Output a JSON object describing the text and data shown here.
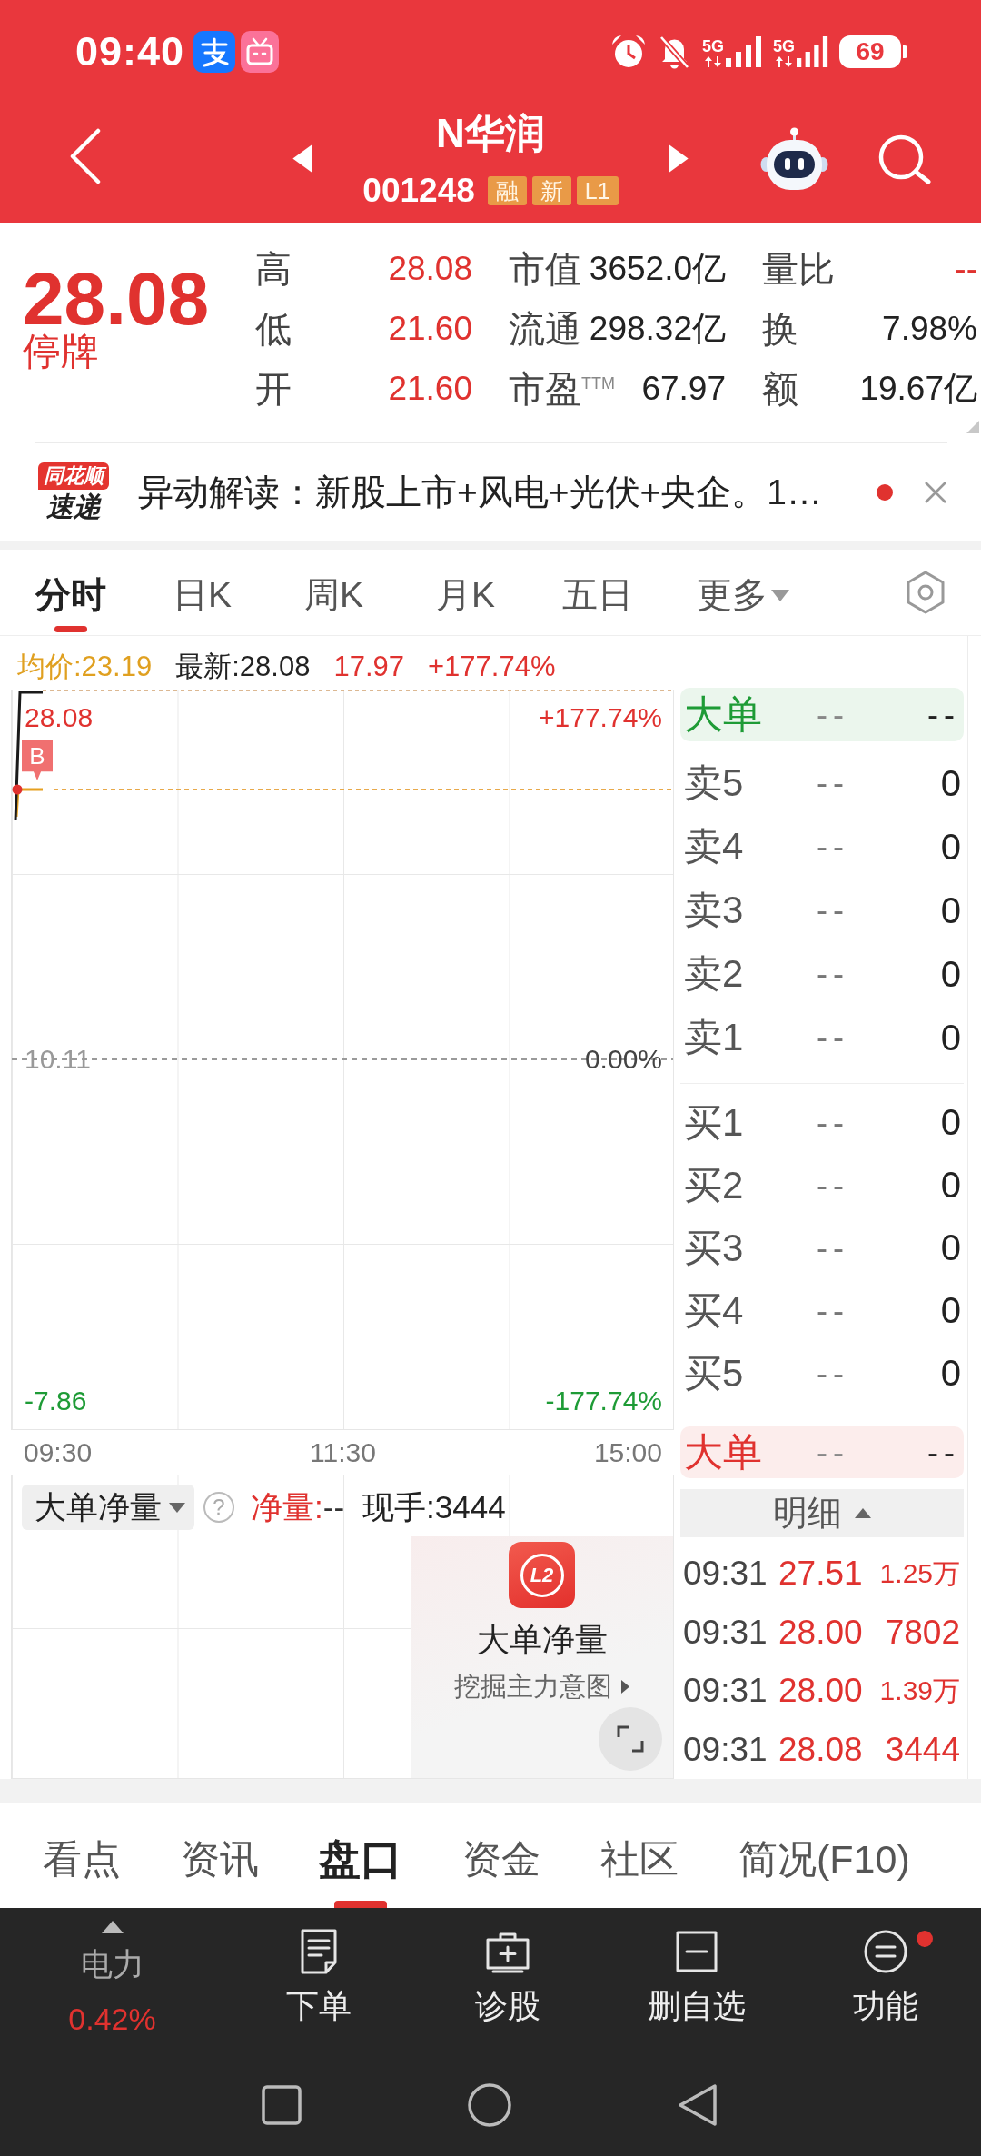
{
  "status_bar": {
    "time": "09:40",
    "networks": [
      "5G",
      "5G"
    ],
    "battery": "69"
  },
  "header": {
    "title": "N华润",
    "code": "001248",
    "tags": [
      "融",
      "新",
      "L1"
    ]
  },
  "quote": {
    "price": "28.08",
    "status": "停牌",
    "stats": [
      {
        "label": "高",
        "value": "28.08",
        "color": "#e0322f"
      },
      {
        "label": "市值",
        "value": "3652.0亿",
        "color": "#222222"
      },
      {
        "label": "量比",
        "value": "--",
        "color": "#e0322f"
      },
      {
        "label": "低",
        "value": "21.60",
        "color": "#e0322f"
      },
      {
        "label": "流通",
        "value": "298.32亿",
        "color": "#222222"
      },
      {
        "label": "换",
        "value": "7.98%",
        "color": "#222222"
      },
      {
        "label": "开",
        "value": "21.60",
        "color": "#e0322f"
      },
      {
        "label": "市盈$^{TTM}$",
        "value": "67.97",
        "color": "#222222"
      },
      {
        "label": "额",
        "value": "19.67亿",
        "color": "#222222"
      }
    ]
  },
  "news": {
    "logo_top": "同花顺",
    "logo_bottom": "速递",
    "text": "异动解读：新股上市+风电+光伏+央企。1…",
    "unread": true
  },
  "chart_tabs": [
    {
      "label": "分时",
      "kind": "tab",
      "selected": true
    },
    {
      "label": "日K",
      "kind": "tab",
      "selected": false
    },
    {
      "label": "周K",
      "kind": "tab",
      "selected": false
    },
    {
      "label": "月K",
      "kind": "tab",
      "selected": false
    },
    {
      "label": "五日",
      "kind": "tab",
      "selected": false
    },
    {
      "label": "更多",
      "kind": "menu",
      "selected": false
    }
  ],
  "chart": {
    "info": [
      {
        "text": "均价:23.19",
        "color": "#e0a020"
      },
      {
        "text": "最新:28.08",
        "color": "#222222"
      },
      {
        "text": "17.97",
        "color": "#e0322f"
      },
      {
        "text": "+177.74%",
        "color": "#e0322f"
      }
    ],
    "price_labels": [
      "28.08",
      "10.11",
      "-7.86"
    ],
    "percent_labels": [
      "+177.74%",
      "0.00%",
      "-177.74%"
    ],
    "buy_marker": "B",
    "time_labels": [
      "09:30",
      "11:30",
      "15:00"
    ]
  },
  "indicator": {
    "selector": "大单净量",
    "help": "?",
    "net_label": "净量:",
    "net_value": "--",
    "current_volume": "现手:3444",
    "promo": {
      "logo": "L2",
      "title": "大单净量",
      "link": "挖掘主力意图"
    }
  },
  "order_book": {
    "big_order_top": {
      "label": "大单",
      "price": "--",
      "volume": "--",
      "color": "#1e9b36"
    },
    "asks": [
      {
        "label": "卖5",
        "price": "--",
        "volume": "0"
      },
      {
        "label": "卖4",
        "price": "--",
        "volume": "0"
      },
      {
        "label": "卖3",
        "price": "--",
        "volume": "0"
      },
      {
        "label": "卖2",
        "price": "--",
        "volume": "0"
      },
      {
        "label": "卖1",
        "price": "--",
        "volume": "0"
      }
    ],
    "bids": [
      {
        "label": "买1",
        "price": "--",
        "volume": "0"
      },
      {
        "label": "买2",
        "price": "--",
        "volume": "0"
      },
      {
        "label": "买3",
        "price": "--",
        "volume": "0"
      },
      {
        "label": "买4",
        "price": "--",
        "volume": "0"
      },
      {
        "label": "买5",
        "price": "--",
        "volume": "0"
      }
    ],
    "big_order_bottom": {
      "label": "大单",
      "price": "--",
      "volume": "--",
      "color": "#e0322f"
    }
  },
  "trade_detail": {
    "title": "明细",
    "trades": [
      {
        "time": "09:31",
        "price": "27.51",
        "volume": "1.25万"
      },
      {
        "time": "09:31",
        "price": "28.00",
        "volume": "7802"
      },
      {
        "time": "09:31",
        "price": "28.00",
        "volume": "1.39万"
      },
      {
        "time": "09:31",
        "price": "28.08",
        "volume": "3444"
      }
    ]
  },
  "bottom_tabs": [
    {
      "label": "看点",
      "selected": false
    },
    {
      "label": "资讯",
      "selected": false
    },
    {
      "label": "盘口",
      "selected": true
    },
    {
      "label": "资金",
      "selected": false
    },
    {
      "label": "社区",
      "selected": false
    },
    {
      "label": "简况(F10)",
      "selected": false
    }
  ],
  "toolbar": [
    {
      "kind": "index",
      "label": "电力",
      "value": "0.42%",
      "rising": true
    },
    {
      "kind": "order",
      "label": "下单"
    },
    {
      "kind": "diagnose",
      "label": "诊股"
    },
    {
      "kind": "remove",
      "label": "删自选"
    },
    {
      "kind": "menu",
      "label": "功能",
      "notification": true
    }
  ]
}
